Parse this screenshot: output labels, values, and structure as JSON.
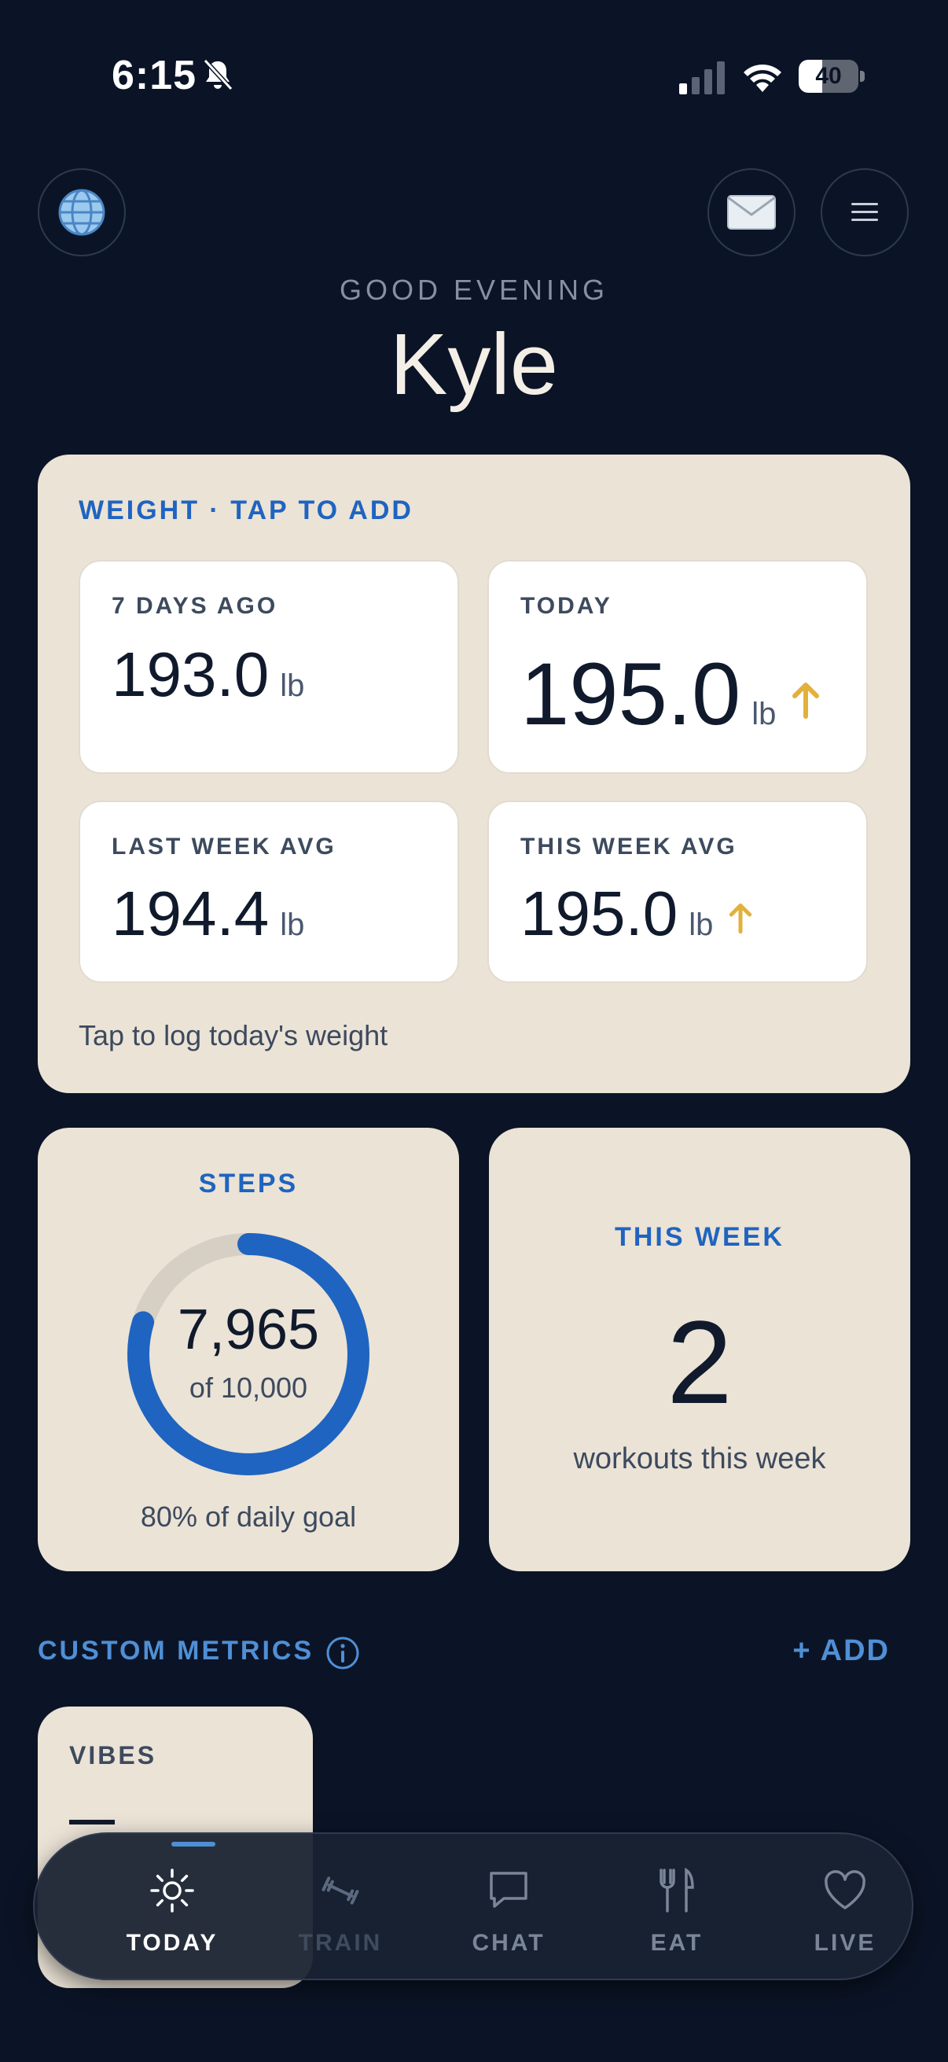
{
  "status": {
    "time": "6:15",
    "battery": "40",
    "battery_level": 0.4
  },
  "header": {
    "greeting": "GOOD EVENING",
    "name": "Kyle"
  },
  "icons": {
    "left": "globe-icon",
    "mail": "mail-icon",
    "menu": "hamburger-menu-icon"
  },
  "weight": {
    "label": "WEIGHT · TAP TO ADD",
    "tiles": [
      {
        "label": "7 DAYS AGO",
        "value": "193.0",
        "unit": "lb"
      },
      {
        "label": "TODAY",
        "value": "195.0",
        "unit": "lb",
        "trend": "up"
      },
      {
        "label": "LAST WEEK AVG",
        "value": "194.4",
        "unit": "lb"
      },
      {
        "label": "THIS WEEK AVG",
        "value": "195.0",
        "unit": "lb",
        "trend": "up"
      }
    ],
    "hint": "Tap to log today's weight",
    "trend_color": "#e2b13c"
  },
  "steps": {
    "label": "STEPS",
    "value": "7,965",
    "goal_text": "of 10,000",
    "progress": 0.7965,
    "footer": "80% of daily goal",
    "ring_color": "#1f64c0",
    "track_color": "#d6cfc4"
  },
  "week": {
    "label": "THIS WEEK",
    "count": "2",
    "sub": "workouts this week"
  },
  "metrics": {
    "title": "CUSTOM METRICS",
    "add": "+ ADD",
    "items": [
      {
        "label": "VIBES",
        "value": "—"
      }
    ]
  },
  "tabs": [
    {
      "label": "TODAY",
      "icon": "sun-icon",
      "active": true
    },
    {
      "label": "TRAIN",
      "icon": "dumbbell-icon"
    },
    {
      "label": "CHAT",
      "icon": "chat-bubble-icon"
    },
    {
      "label": "EAT",
      "icon": "fork-knife-icon"
    },
    {
      "label": "LIVE",
      "icon": "heart-icon"
    }
  ]
}
